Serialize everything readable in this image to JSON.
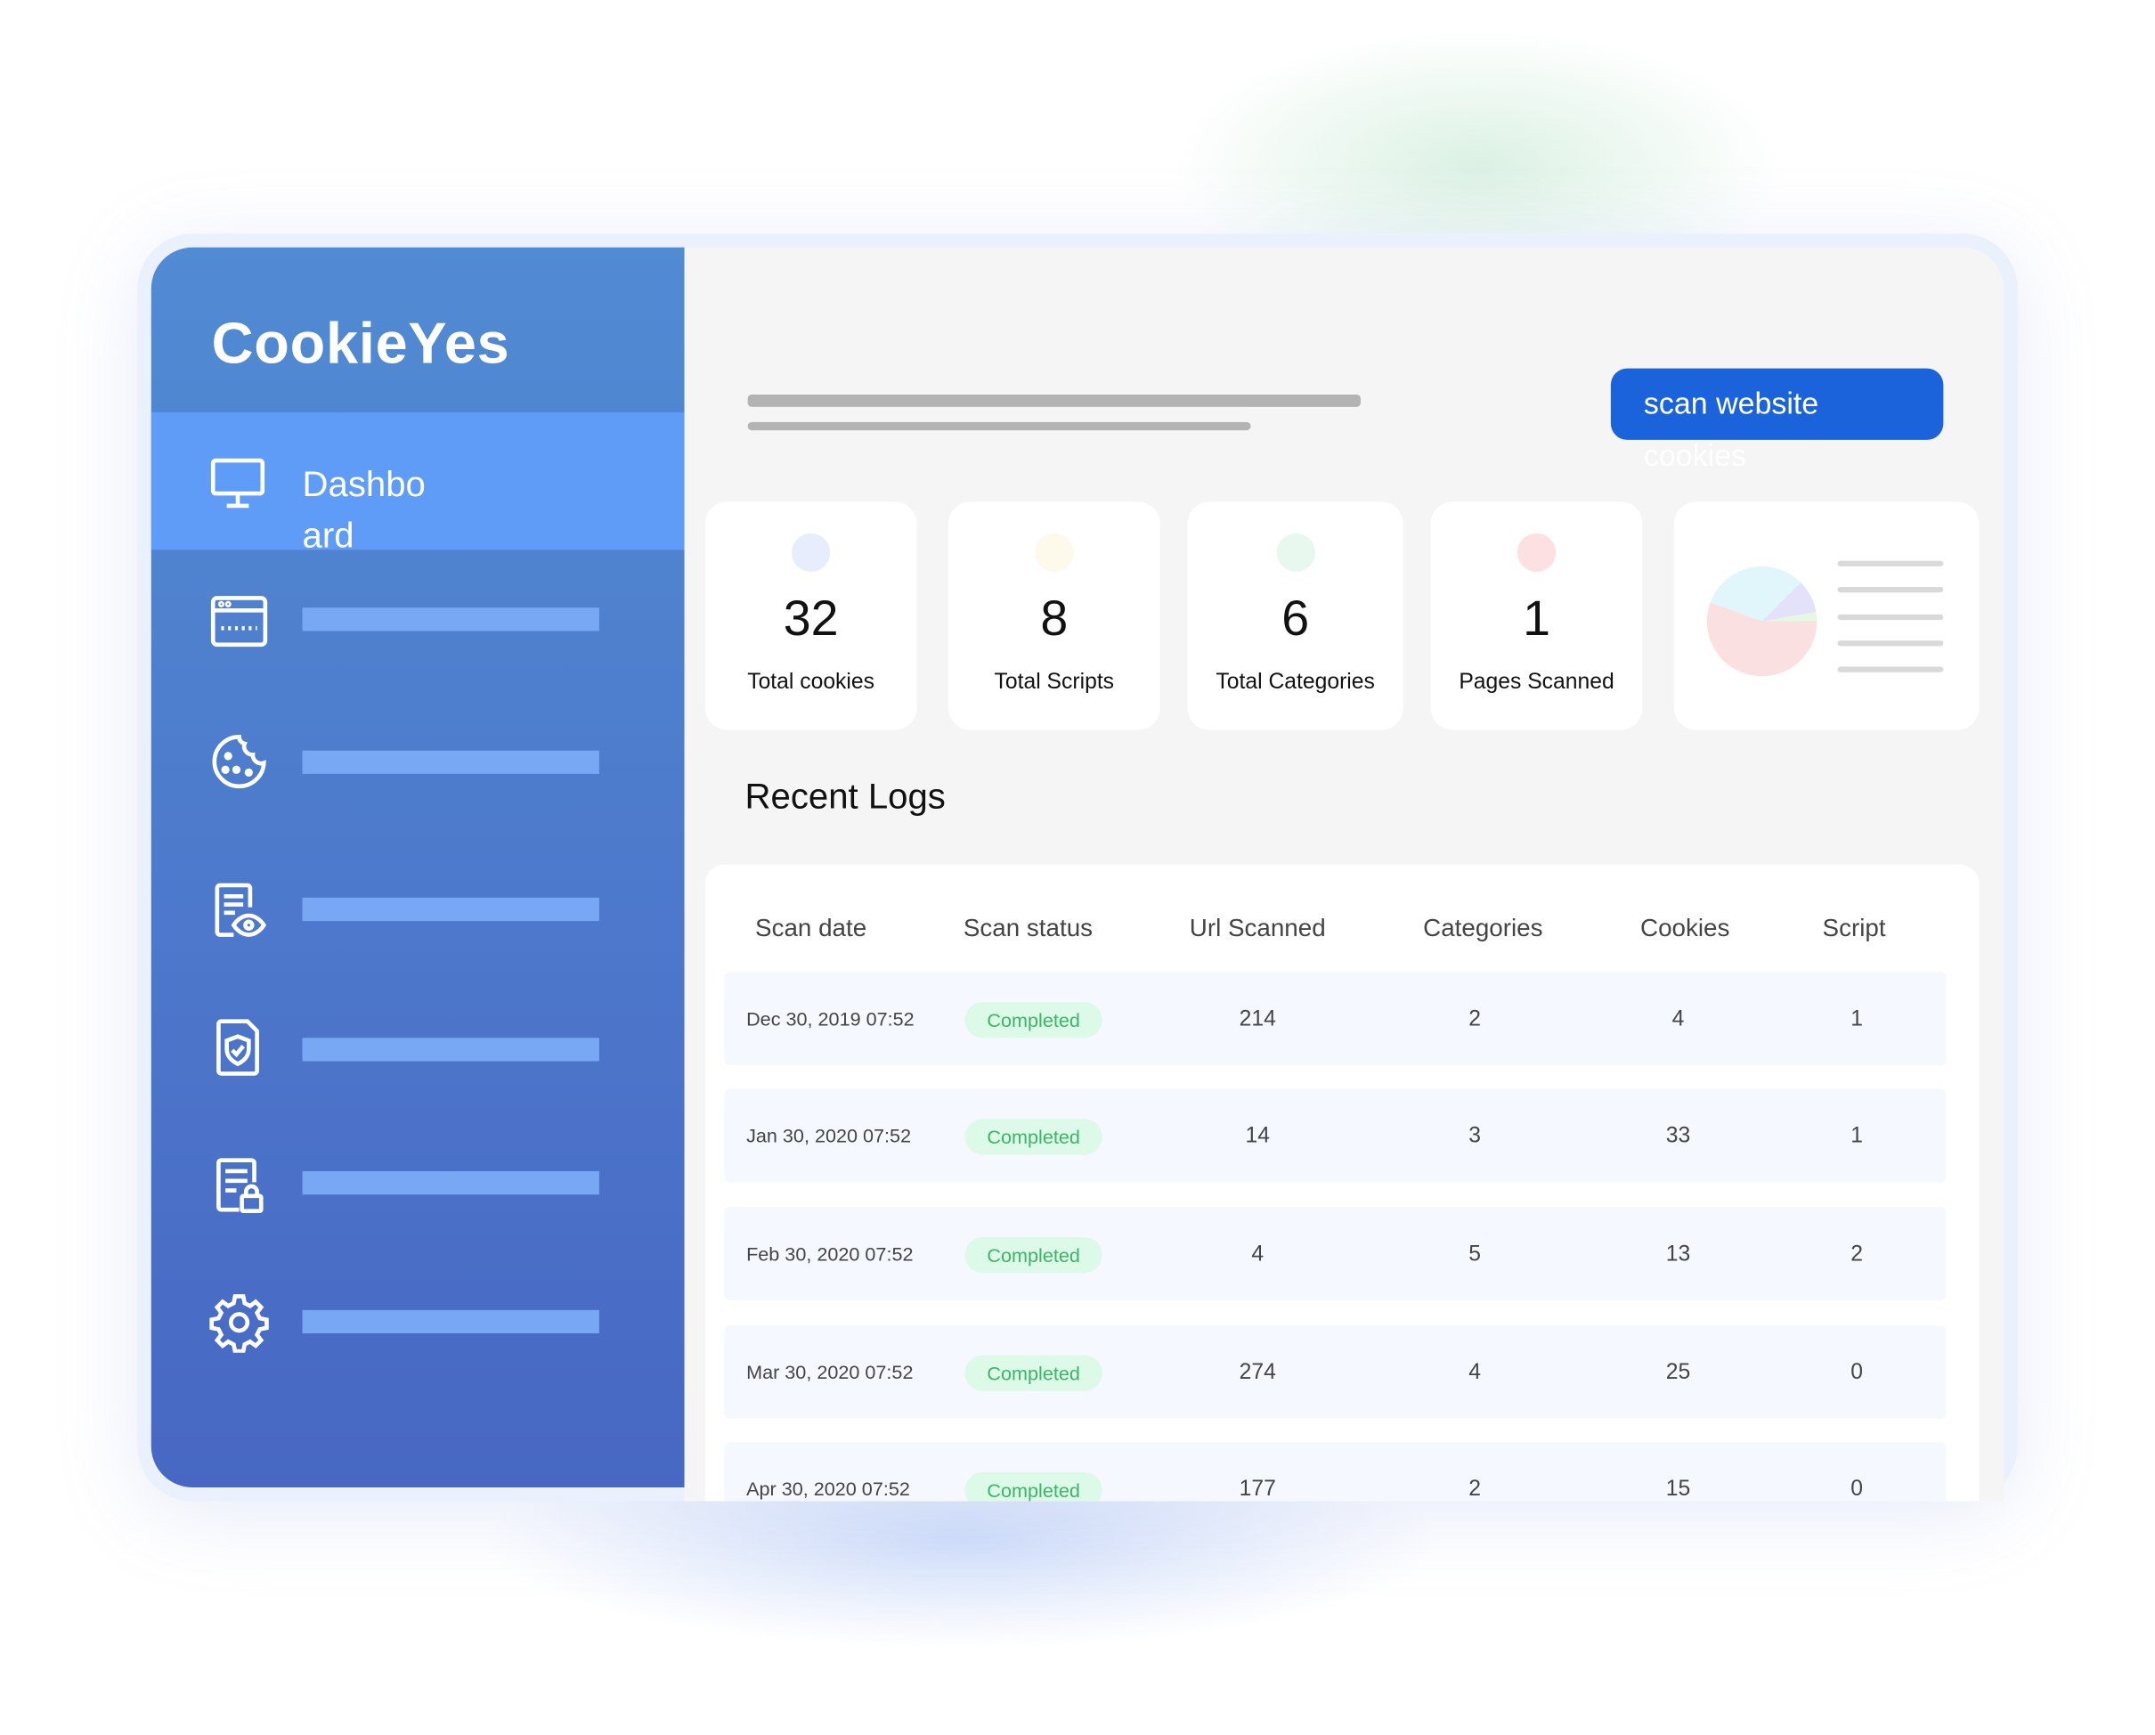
{
  "brand": {
    "logo_text": "CookieYes"
  },
  "sidebar": {
    "active_item": {
      "label": "Dashboard",
      "icon": "monitor-icon"
    },
    "items": [
      {
        "icon": "browser-window-icon"
      },
      {
        "icon": "cookie-icon"
      },
      {
        "icon": "document-eye-icon"
      },
      {
        "icon": "document-shield-icon"
      },
      {
        "icon": "document-lock-icon"
      },
      {
        "icon": "gear-icon"
      }
    ]
  },
  "header": {
    "scan_button_label": "scan website",
    "scan_button_overflow": "cookies",
    "accent_color": "#1a63db"
  },
  "stats": [
    {
      "value": "32",
      "label": "Total cookies",
      "color": "#e8edfd"
    },
    {
      "value": "8",
      "label": "Total Scripts",
      "color": "#fdfaeb"
    },
    {
      "value": "6",
      "label": "Total Categories",
      "color": "#e9f8ef"
    },
    {
      "value": "1",
      "label": "Pages Scanned",
      "color": "#fde0e1"
    }
  ],
  "pie_colors": [
    "#fbe0e2",
    "#e1f6fa",
    "#e4e2fb",
    "#e6f8e4"
  ],
  "recent_logs": {
    "title": "Recent Logs",
    "columns": [
      "Scan date",
      "Scan status",
      "Url Scanned",
      "Categories",
      "Cookies",
      "Script"
    ],
    "rows": [
      {
        "date": "Dec 30, 2019 07:52",
        "status": "Completed",
        "urls": "214",
        "categories": "2",
        "cookies": "4",
        "script": "1"
      },
      {
        "date": "Jan 30, 2020 07:52",
        "status": "Completed",
        "urls": "14",
        "categories": "3",
        "cookies": "33",
        "script": "1"
      },
      {
        "date": "Feb 30, 2020 07:52",
        "status": "Completed",
        "urls": "4",
        "categories": "5",
        "cookies": "13",
        "script": "2"
      },
      {
        "date": "Mar 30, 2020 07:52",
        "status": "Completed",
        "urls": "274",
        "categories": "4",
        "cookies": "25",
        "script": "0"
      },
      {
        "date": "Apr 30, 2020 07:52",
        "status": "Completed",
        "urls": "177",
        "categories": "2",
        "cookies": "15",
        "script": "0"
      }
    ]
  }
}
